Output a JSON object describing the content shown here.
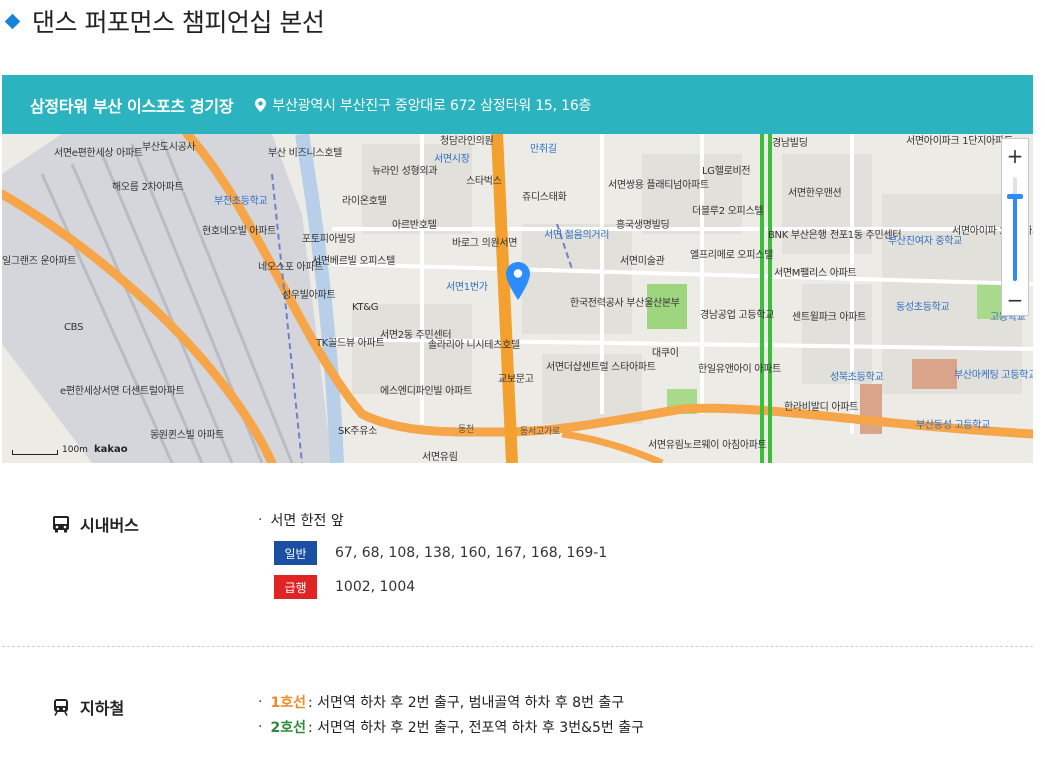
{
  "page": {
    "title": "댄스 퍼포먼스 챔피언십 본선"
  },
  "venue": {
    "name": "삼정타워 부산 이스포츠 경기장",
    "address": "부산광역시 부산진구 중앙대로 672 삼정타워 15, 16층"
  },
  "map": {
    "zoom_in": "+",
    "zoom_out": "−",
    "scale": "100m",
    "provider": "kakao",
    "zoom_level": 0.82,
    "labels": [
      "서면e편한세상 아파트",
      "부산도시공사",
      "해오름 2차아파트",
      "부전초등학교",
      "현호네오빌 아파트",
      "일그랜즈 운아파트",
      "네오스포 아파트",
      "성우빌아파트",
      "CBS",
      "e편한세상서면 더센트럴아파트",
      "동원퀸스빌 아파트",
      "부산 비즈니스호텔",
      "뉴라인 성형외과",
      "라이온호텔",
      "아르반호텔",
      "포토피아빌딩",
      "서면베르빌 오피스텔",
      "KT&G",
      "서면2동 주민센터",
      "TK골드뷰 아파트",
      "솔라리아 니시테츠호텔",
      "에스엔디파인빌 아파트",
      "SK주유소",
      "서면유림",
      "청담라인의원",
      "서면시장",
      "스타벅스",
      "바로그 의원서면",
      "서면1번가",
      "만취길",
      "쥬디스태화",
      "서면 젊음의거리",
      "한국전력공사 부산울산본부",
      "교보문고",
      "서면더샵센트럴 스타아파트",
      "서면쌍용 플래티넘아파트",
      "흥국생명빌딩",
      "서면미술관",
      "대쿠이",
      "더블루2 오피스텔",
      "엘프리메로 오피스텔",
      "경남공업 고등학교",
      "한일유앤아이 아파트",
      "서면유림노르웨이 아침아파트",
      "LG헬로비전",
      "경남빌딩",
      "서면한우맨션",
      "BNK 부산은행",
      "서면M팰리스 아파트",
      "센트윌파크 아파트",
      "한라비발디 아파트",
      "성북초등학교",
      "전포1동 주민센터",
      "서면아이파크 1단지아파트",
      "부산진여자 중학교",
      "서면아이파 2단지아파",
      "동성초등학교",
      "부산마케팅 고등학교",
      "부산동성 고등학교",
      "고등학교",
      "동서고가로",
      "동천"
    ]
  },
  "transport": {
    "bus": {
      "title": "시내버스",
      "stop": "서면 한전 앞",
      "routes": [
        {
          "type": "일반",
          "color": "#1a4fa3",
          "numbers": "67, 68, 108, 138, 160, 167, 168, 169-1"
        },
        {
          "type": "급행",
          "color": "#e02424",
          "numbers": "1002, 1004"
        }
      ]
    },
    "subway": {
      "title": "지하철",
      "lines": [
        {
          "name": "1호선",
          "color": "#f08a24",
          "text": " : 서면역 하차 후 2번 출구, 범내골역 하차 후 8번 출구"
        },
        {
          "name": "2호선",
          "color": "#2e8b3a",
          "text": " : 서면역 하차 후 2번 출구, 전포역 하차 후 3번&5번 출구"
        }
      ]
    }
  },
  "colors": {
    "accent": "#2bb3c0",
    "bullet": "#1a82d9"
  }
}
